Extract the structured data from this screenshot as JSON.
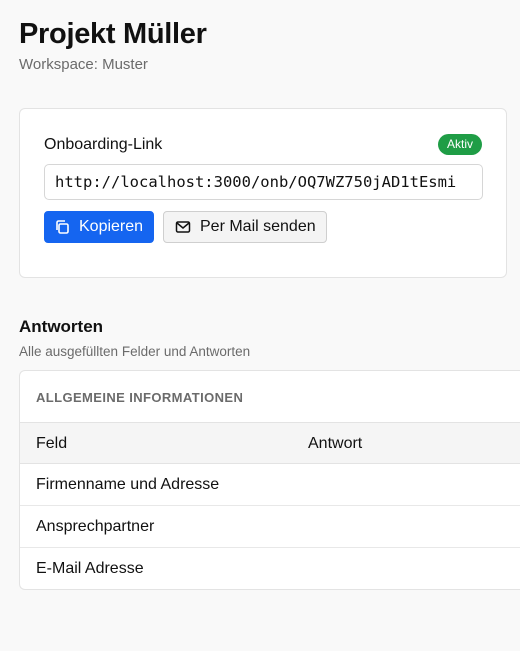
{
  "header": {
    "title": "Projekt Müller",
    "workspace": "Workspace: Muster"
  },
  "onboarding": {
    "title": "Onboarding-Link",
    "status": "Aktiv",
    "status_color": "#1f9d46",
    "url": "http://localhost:3000/onb/OQ7WZ750jAD1tEsmi",
    "copy_label": "Kopieren",
    "copy_icon": "copy-icon",
    "mail_label": "Per Mail senden",
    "mail_icon": "mail-icon",
    "primary_color": "#1565f0"
  },
  "answers": {
    "title": "Antworten",
    "subtitle": "Alle ausgefüllten Felder und Antworten",
    "group": "ALLGEMEINE INFORMATIONEN",
    "columns": [
      "Feld",
      "Antwort"
    ],
    "rows": [
      {
        "field": "Firmenname und Adresse",
        "answer": ""
      },
      {
        "field": "Ansprechpartner",
        "answer": ""
      },
      {
        "field": "E-Mail Adresse",
        "answer": ""
      }
    ]
  }
}
